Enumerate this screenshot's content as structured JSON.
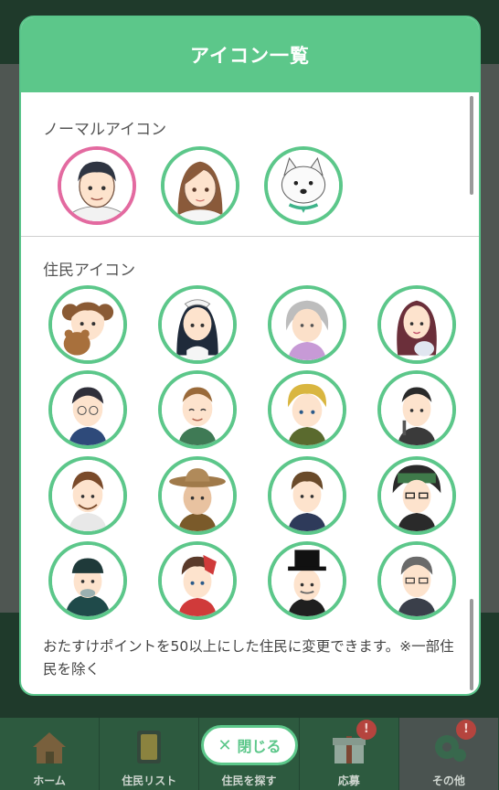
{
  "modal": {
    "title": "アイコン一覧",
    "normal_section_title": "ノーマルアイコン",
    "resident_section_title": "住民アイコン",
    "note": "おたすけポイントを50以上にした住民に変更できます。※一部住民を除く"
  },
  "normal_icons": [
    {
      "name": "male-avatar",
      "selected": true
    },
    {
      "name": "female-avatar",
      "selected": false
    },
    {
      "name": "dog-avatar",
      "selected": false
    }
  ],
  "close_button": {
    "label": "閉じる",
    "icon": "close-icon"
  },
  "tabbar": {
    "tabs": [
      {
        "label": "ホーム",
        "icon": "house-icon",
        "badge": ""
      },
      {
        "label": "住民リスト",
        "icon": "book-icon",
        "badge": ""
      },
      {
        "label": "住民を探す",
        "icon": "search-icon",
        "badge": ""
      },
      {
        "label": "応募",
        "icon": "gift-icon",
        "badge": "!"
      },
      {
        "label": "その他",
        "icon": "gear-icon",
        "badge": "!"
      }
    ]
  },
  "colors": {
    "accent": "#5cc78a",
    "selected_border": "#e36aa0",
    "badge": "#b5443e"
  }
}
